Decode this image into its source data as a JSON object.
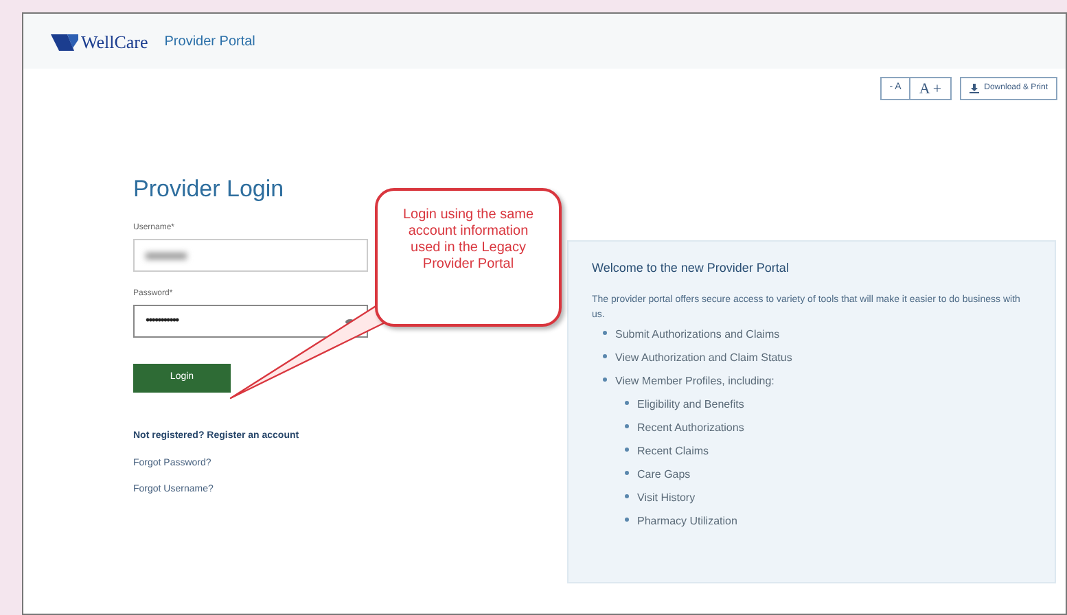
{
  "header": {
    "logo": "WellCare",
    "title": "Provider Portal"
  },
  "toolbar": {
    "font_smaller": "- A",
    "font_larger": "A +",
    "download": "Download & Print"
  },
  "login": {
    "title": "Provider Login",
    "username_label": "Username*",
    "password_label": "Password*",
    "password_value": "•••••••••••",
    "button": "Login",
    "register": "Not registered? Register an account",
    "links": [
      "Forgot Password?",
      "Forgot Username?"
    ]
  },
  "callout": {
    "text": "Login using the same account information used in the Legacy Provider Portal"
  },
  "welcome": {
    "title": "Welcome to the new Provider Portal",
    "intro": "The provider portal offers secure access to variety of tools that will make it easier to do business with us.",
    "items": [
      {
        "text": "Submit Authorizations and Claims"
      },
      {
        "text": "View Authorization and Claim Status"
      },
      {
        "text": "View Member Profiles, including:",
        "children": [
          {
            "text": "Eligibility and Benefits"
          },
          {
            "text": "Recent Authorizations"
          },
          {
            "text": "Recent Claims"
          },
          {
            "text": "Care Gaps"
          },
          {
            "text": "Visit History"
          },
          {
            "text": "Pharmacy Utilization"
          }
        ]
      }
    ]
  }
}
